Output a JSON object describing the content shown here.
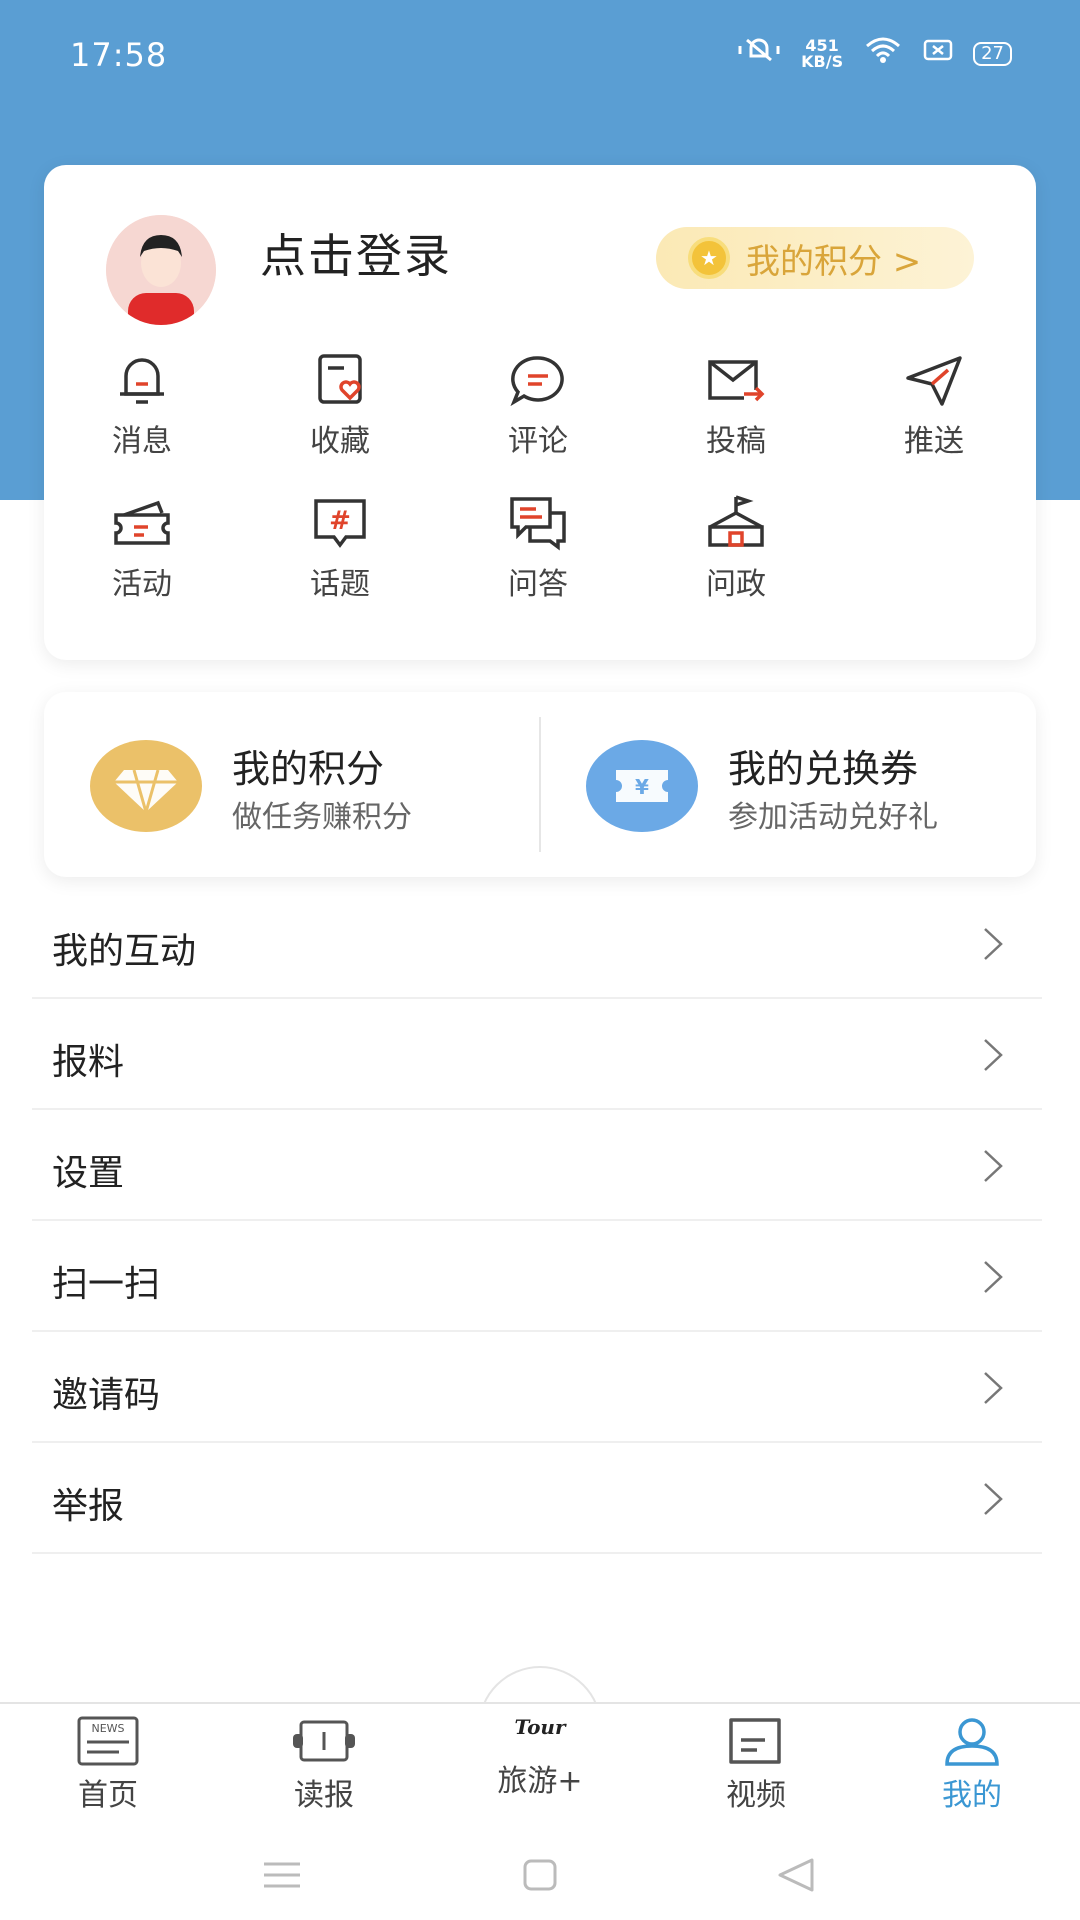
{
  "status": {
    "time": "17:58",
    "net_speed_value": "451",
    "net_speed_unit": "KB/S",
    "battery": "27"
  },
  "profile": {
    "login_text": "点击登录",
    "points_pill": "我的积分 >"
  },
  "shortcuts": [
    {
      "label": "消息",
      "icon": "bell-icon"
    },
    {
      "label": "收藏",
      "icon": "favorite-icon"
    },
    {
      "label": "评论",
      "icon": "comment-icon"
    },
    {
      "label": "投稿",
      "icon": "submit-mail-icon"
    },
    {
      "label": "推送",
      "icon": "send-icon"
    },
    {
      "label": "活动",
      "icon": "ticket-icon"
    },
    {
      "label": "话题",
      "icon": "topic-hash-icon"
    },
    {
      "label": "问答",
      "icon": "qa-icon"
    },
    {
      "label": "问政",
      "icon": "government-building-icon"
    }
  ],
  "rewards": {
    "points": {
      "title": "我的积分",
      "subtitle": "做任务赚积分",
      "icon": "diamond-icon",
      "color": "#ebc169"
    },
    "vouchers": {
      "title": "我的兑换券",
      "subtitle": "参加活动兑好礼",
      "icon": "voucher-icon",
      "color": "#6ba9e6"
    }
  },
  "menu": [
    {
      "label": "我的互动"
    },
    {
      "label": "报料"
    },
    {
      "label": "设置"
    },
    {
      "label": "扫一扫"
    },
    {
      "label": "邀请码"
    },
    {
      "label": "举报"
    }
  ],
  "tabbar": [
    {
      "label": "首页",
      "icon": "news-icon",
      "active": false
    },
    {
      "label": "读报",
      "icon": "newspaper-scroll-icon",
      "active": false
    },
    {
      "label": "旅游+",
      "icon": "tour-logo-icon",
      "logo_text": "Tour",
      "active": false
    },
    {
      "label": "视频",
      "icon": "video-icon",
      "active": false
    },
    {
      "label": "我的",
      "icon": "profile-icon",
      "active": true
    }
  ],
  "colors": {
    "header": "#5a9ed3",
    "accent": "#3b97d3",
    "icon_red": "#e0442b",
    "icon_dark": "#333333"
  }
}
